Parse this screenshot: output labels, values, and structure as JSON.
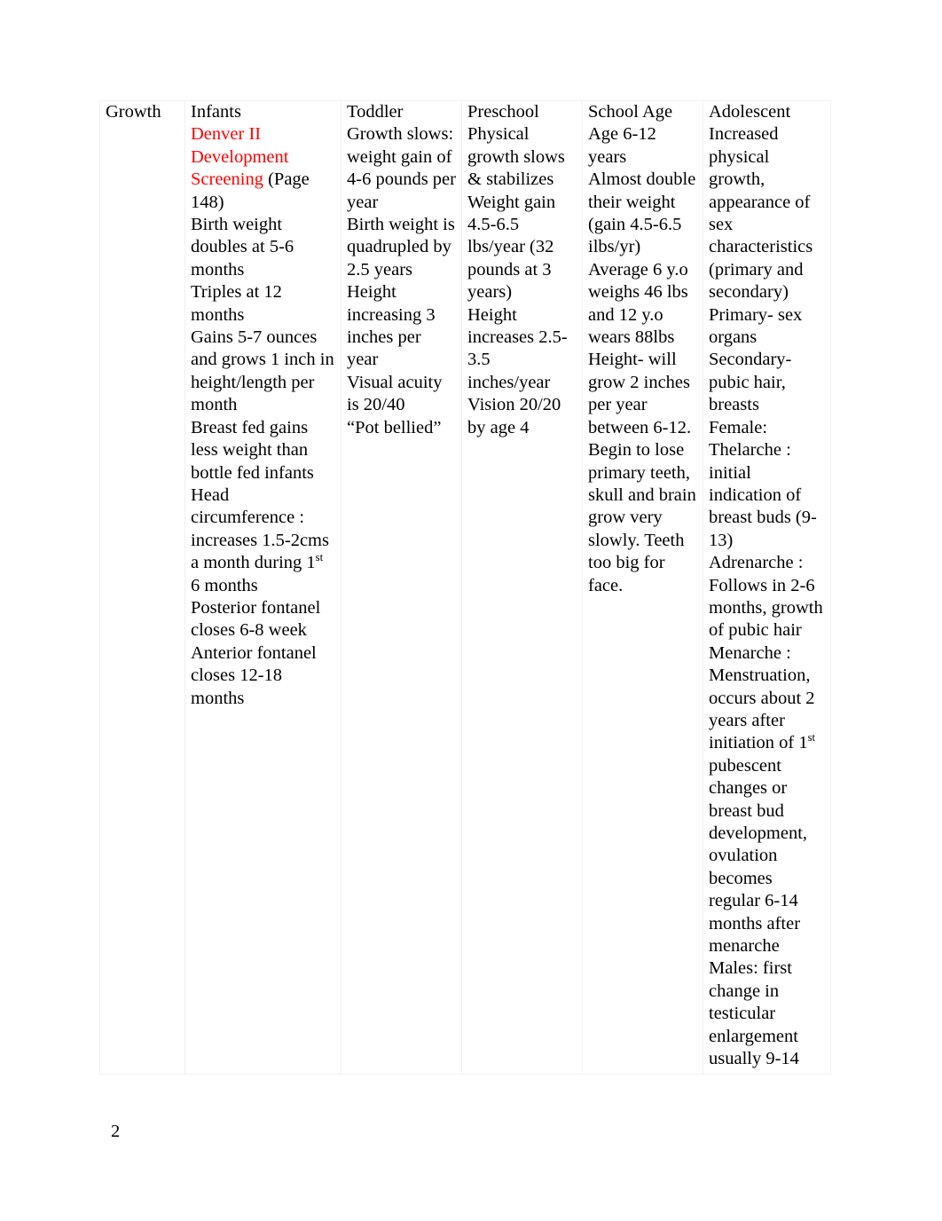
{
  "document": {
    "page_number": "2",
    "accent_colors": {
      "row_label": "#a31ec4",
      "highlight_term": "#ff0000",
      "table_border": "#f1f1f1",
      "text": "#000000"
    }
  },
  "table": {
    "row_label": "Growth",
    "headers": {
      "infants": "Infants",
      "toddler": "Toddler",
      "preschool": "Preschool",
      "school_age": "School Age",
      "adolescent": "Adolescent"
    },
    "cells": {
      "infants": {
        "highlight_term": "Denver II Development Screening",
        "highlight_suffix": " (Page 148)",
        "lines": [
          "Birth weight doubles at 5-6 months",
          "Triples at 12 months",
          "Gains 5-7 ounces and grows 1 inch in height/length per month",
          "Breast fed gains less weight than bottle fed infants",
          "Head circumference : increases 1.5-2cms a month during 1st 6 months",
          "Posterior fontanel  closes 6-8 week",
          "Anterior fontanel closes 12-18 months"
        ],
        "line_head_circumference_pre": "Head circumference : increases 1.5-2cms a month during 1",
        "line_head_circumference_sup": "st",
        "line_head_circumference_post": " 6 months"
      },
      "toddler": {
        "lines": [
          "Growth slows: weight gain of 4-6 pounds per year",
          "Birth weight is quadrupled by 2.5 years",
          "Height increasing 3 inches per year",
          "Visual acuity is 20/40",
          "“Pot bellied”"
        ]
      },
      "preschool": {
        "lines": [
          "Physical growth slows & stabilizes",
          "Weight gain 4.5-6.5 lbs/year (32 pounds at 3 years)",
          "Height increases 2.5-3.5 inches/year",
          "Vision 20/20 by age 4"
        ]
      },
      "school_age": {
        "lines": [
          "Age 6-12 years",
          "Almost double their weight (gain 4.5-6.5 ilbs/yr)",
          "Average 6 y.o weighs 46 lbs and 12 y.o wears 88lbs",
          "Height- will grow 2 inches per year between 6-12.",
          "Begin to lose primary teeth, skull and brain grow very slowly. Teeth too big for face."
        ]
      },
      "adolescent": {
        "lines": [
          "Increased physical growth, appearance of sex characteristics (primary and secondary)",
          "Primary- sex organs",
          "Secondary- pubic hair, breasts",
          "Female: Thelarche : initial indication of breast buds (9-13)",
          "Adrenarche : Follows in 2-6 months, growth of pubic hair",
          "Menarche : Menstruation, occurs about 2 years after initiation of 1st pubescent changes or breast bud development, ovulation becomes regular 6-14 months after menarche",
          "Males: first change in testicular enlargement usually 9-14"
        ],
        "line_menarche_pre": "Menarche : Menstruation, occurs about 2 years after initiation of 1",
        "line_menarche_sup": "st",
        "line_menarche_post": " pubescent changes or breast bud development, ovulation becomes regular 6-14 months after menarche"
      }
    }
  }
}
